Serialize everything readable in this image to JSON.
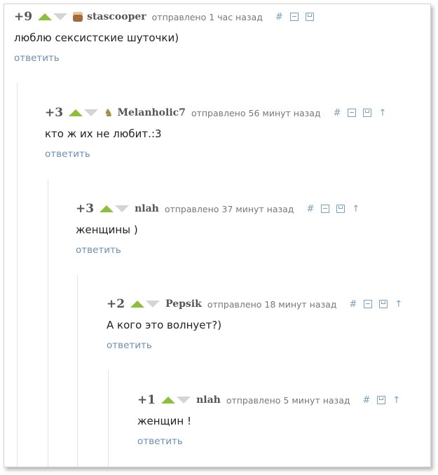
{
  "comments": [
    {
      "rating": "+9",
      "username": "stascooper",
      "posted_label": "отправлено",
      "time": "1 час назад",
      "text": "люблю сексистские шуточки)",
      "reply_label": "ответить",
      "avatar_icon": "cake-icon",
      "has_parent_link": false
    },
    {
      "rating": "+3",
      "username": "Melanholic7",
      "posted_label": "отправлено",
      "time": "56 минут назад",
      "text": "кто ж их не любит.:3",
      "reply_label": "ответить",
      "avatar_icon": "figure-icon",
      "has_parent_link": true
    },
    {
      "rating": "+3",
      "username": "nlah",
      "posted_label": "отправлено",
      "time": "37 минут назад",
      "text": "женщины )",
      "reply_label": "ответить",
      "has_parent_link": true
    },
    {
      "rating": "+2",
      "username": "Pepsik",
      "posted_label": "отправлено",
      "time": "18 минут назад",
      "text": "А кого это волнует?)",
      "reply_label": "ответить",
      "has_parent_link": true
    },
    {
      "rating": "+1",
      "username": "nlah",
      "posted_label": "отправлено",
      "time": "5 минут назад",
      "text": "женщин !",
      "reply_label": "ответить",
      "has_parent_link": true,
      "no_collapse": true
    }
  ],
  "icons": {
    "link": "hash-icon",
    "collapse": "collapse-icon",
    "save": "save-icon",
    "parent": "arrow-up-icon"
  },
  "colors": {
    "vote_up": "#8ebf3a",
    "vote_down": "#d4d4d4",
    "link": "#6a8fb5",
    "text": "#222222"
  }
}
